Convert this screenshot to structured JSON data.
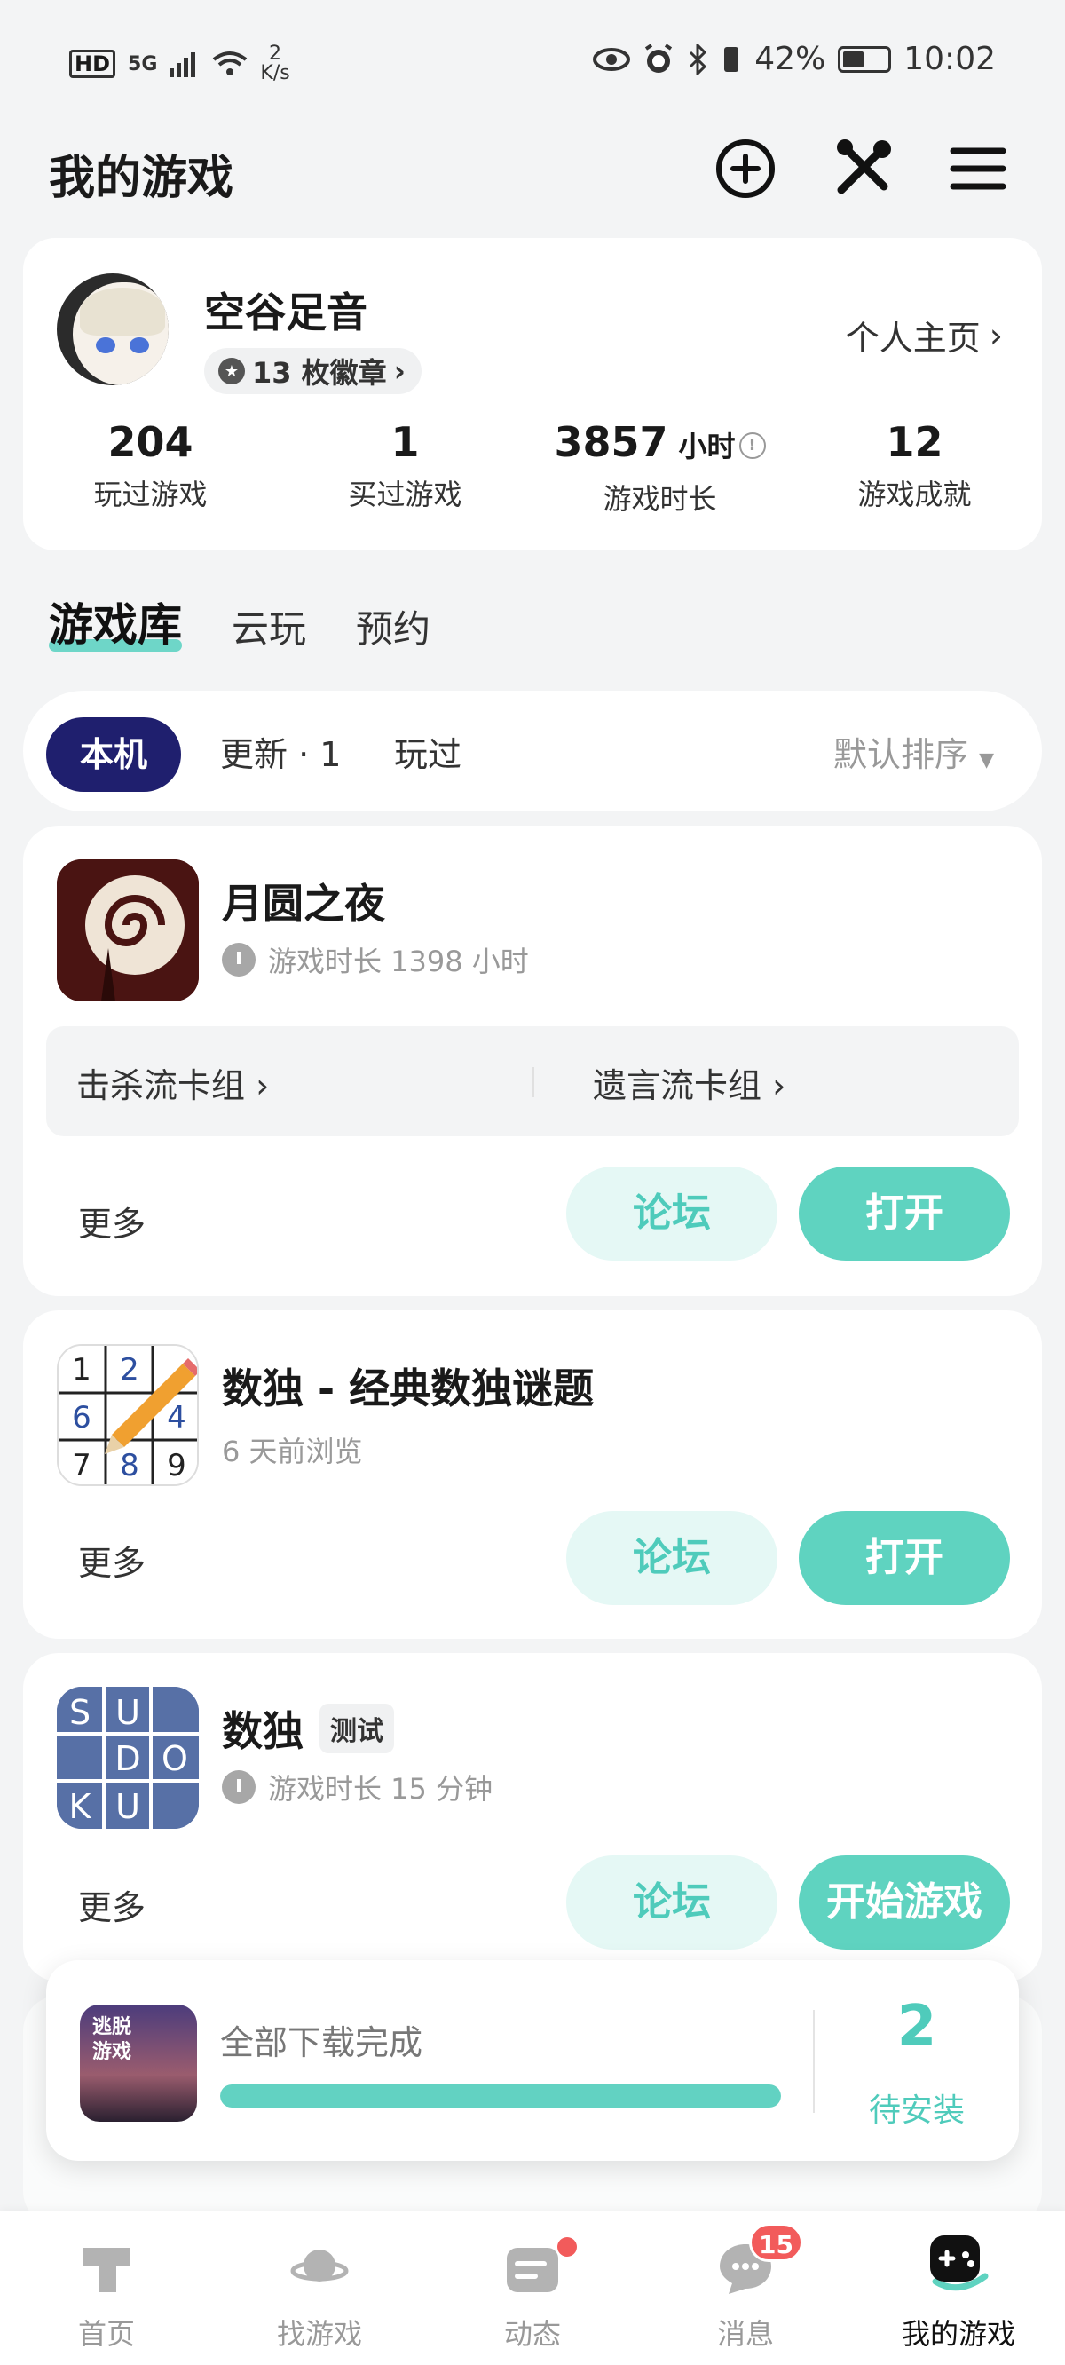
{
  "status_bar": {
    "hd": "HD",
    "signal": "5G",
    "net_speed_value": "2",
    "net_speed_unit": "K/s",
    "battery": "42%",
    "time": "10:02"
  },
  "header": {
    "title": "我的游戏"
  },
  "profile": {
    "username": "空谷足音",
    "badges": "13 枚徽章",
    "homepage_link": "个人主页",
    "stats": [
      {
        "value": "204",
        "unit": "",
        "label": "玩过游戏"
      },
      {
        "value": "1",
        "unit": "",
        "label": "买过游戏"
      },
      {
        "value": "3857",
        "unit": "小时",
        "label": "游戏时长"
      },
      {
        "value": "12",
        "unit": "",
        "label": "游戏成就"
      }
    ]
  },
  "top_tabs": [
    "游戏库",
    "云玩",
    "预约"
  ],
  "filters": {
    "items": [
      "本机",
      "更新 · 1",
      "玩过"
    ],
    "sort": "默认排序"
  },
  "games": [
    {
      "title": "月圆之夜",
      "subtitle": "游戏时长 1398 小时",
      "decks": [
        "击杀流卡组",
        "遗言流卡组"
      ],
      "more": "更多",
      "forum": "论坛",
      "action": "打开"
    },
    {
      "title": "数独 - 经典数独谜题",
      "subtitle": "6 天前浏览",
      "more": "更多",
      "forum": "论坛",
      "action": "打开",
      "icon_digits": [
        "1",
        "2",
        "",
        "6",
        "",
        "4",
        "7",
        "8",
        "9"
      ]
    },
    {
      "title": "数独",
      "tag": "测试",
      "subtitle": "游戏时长 15 分钟",
      "more": "更多",
      "forum": "论坛",
      "action": "开始游戏",
      "icon_letters": [
        "S",
        "U",
        "",
        "",
        "D",
        "O",
        "K",
        "U",
        ""
      ]
    }
  ],
  "download": {
    "icon_text": "逃脱游戏",
    "text": "全部下载完成",
    "progress": 1.0,
    "count": "2",
    "count_label": "待安装"
  },
  "bottom_nav": [
    {
      "label": "首页",
      "icon": "home-icon"
    },
    {
      "label": "找游戏",
      "icon": "planet-icon"
    },
    {
      "label": "动态",
      "icon": "feed-icon"
    },
    {
      "label": "消息",
      "icon": "message-icon",
      "badge": "15"
    },
    {
      "label": "我的游戏",
      "icon": "gamepad-icon"
    }
  ],
  "colors": {
    "accent": "#5fd3c0",
    "accent_light": "#e5f8f5",
    "filter_active": "#1f1f6e",
    "badge": "#f25b5b"
  }
}
